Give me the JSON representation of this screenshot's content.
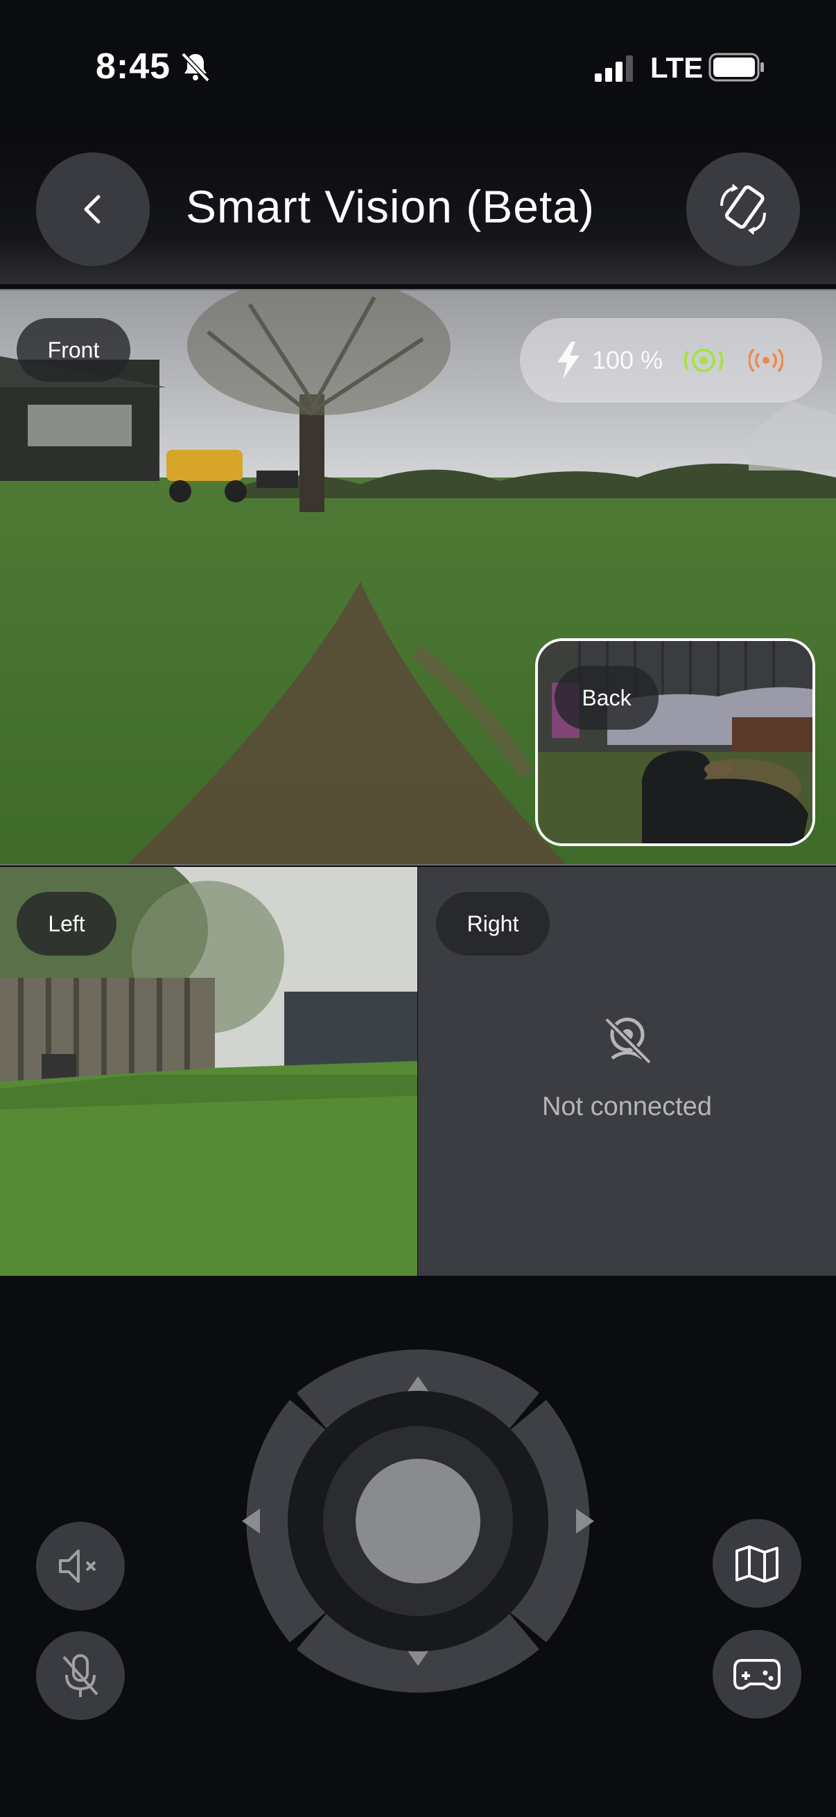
{
  "status_bar": {
    "time": "8:45",
    "network": "LTE"
  },
  "header": {
    "title": "Smart Vision (Beta)"
  },
  "cameras": {
    "front": {
      "label": "Front",
      "battery_text": "100 %"
    },
    "back": {
      "label": "Back"
    },
    "left": {
      "label": "Left"
    },
    "right": {
      "label": "Right",
      "status": "Not connected"
    }
  },
  "icons": {
    "back": "chevron-left-icon",
    "rotate": "screen-rotate-icon",
    "mute": "speaker-muted-icon",
    "mic": "mic-off-icon",
    "map": "map-icon",
    "gamepad": "gamepad-icon"
  },
  "colors": {
    "signal_good": "#a8e04a",
    "signal_warn": "#f0884a",
    "background": "#0b0c10"
  }
}
